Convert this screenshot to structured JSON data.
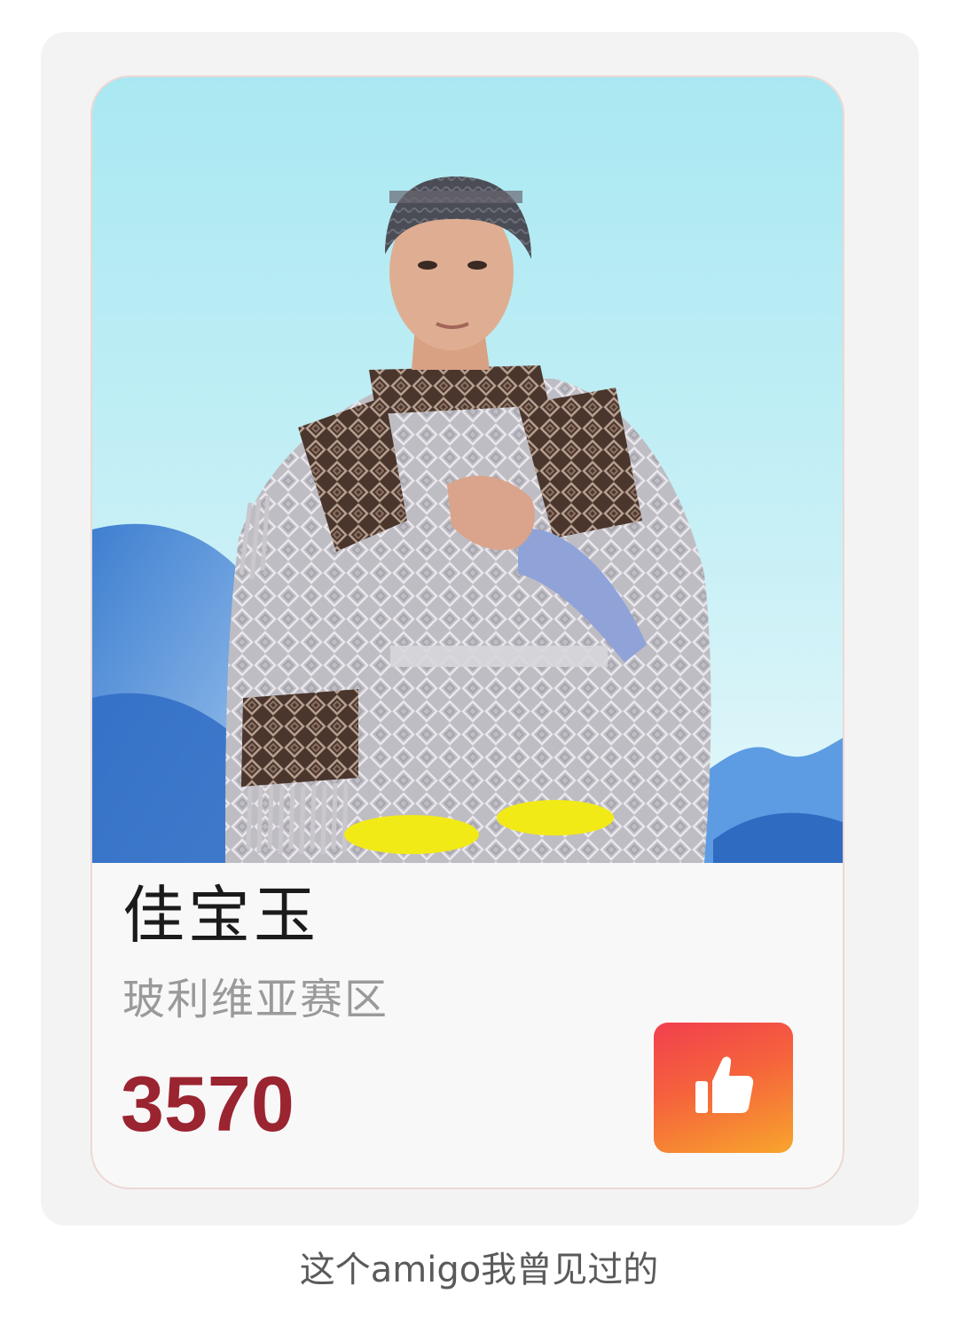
{
  "card": {
    "name": "佳宝玉",
    "region": "玻利维亚赛区",
    "votes": "3570",
    "like_icon": "thumbs-up-icon",
    "photo": "contestant-photo"
  },
  "caption": "这个amigo我曾见过的",
  "colors": {
    "votes_text": "#9b2431",
    "like_gradient_start": "#f23f4e",
    "like_gradient_end": "#f8a52c",
    "region_text": "#9a9a9a"
  }
}
